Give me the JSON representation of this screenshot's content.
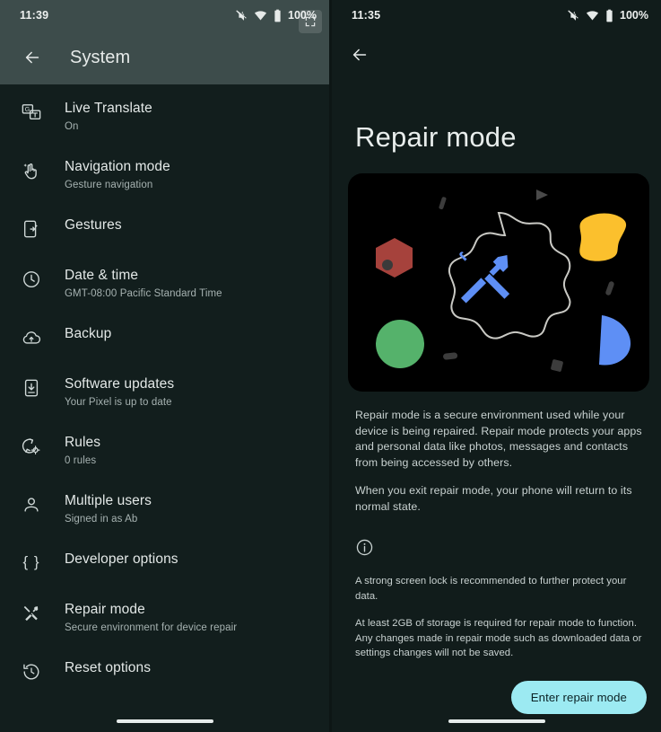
{
  "left": {
    "status": {
      "time": "11:39",
      "battery": "100%",
      "icons": [
        "mute-icon",
        "wifi-icon",
        "battery-icon"
      ],
      "overlay_badge": "fullscreen-icon"
    },
    "toolbar": {
      "title": "System",
      "back": "back-arrow-icon"
    },
    "items": [
      {
        "icon": "live-translate-icon",
        "title": "Live Translate",
        "sub": "On"
      },
      {
        "icon": "gesture-hand-icon",
        "title": "Navigation mode",
        "sub": "Gesture navigation"
      },
      {
        "icon": "gestures-phone-icon",
        "title": "Gestures",
        "sub": ""
      },
      {
        "icon": "clock-icon",
        "title": "Date & time",
        "sub": "GMT-08:00 Pacific Standard Time"
      },
      {
        "icon": "cloud-upload-icon",
        "title": "Backup",
        "sub": ""
      },
      {
        "icon": "software-update-icon",
        "title": "Software updates",
        "sub": "Your Pixel is up to date"
      },
      {
        "icon": "rules-gear-icon",
        "title": "Rules",
        "sub": "0 rules"
      },
      {
        "icon": "person-icon",
        "title": "Multiple users",
        "sub": "Signed in as Ab"
      },
      {
        "icon": "curly-braces-icon",
        "title": "Developer options",
        "sub": ""
      },
      {
        "icon": "repair-tools-icon",
        "title": "Repair mode",
        "sub": "Secure environment for device repair"
      },
      {
        "icon": "history-reset-icon",
        "title": "Reset options",
        "sub": ""
      }
    ]
  },
  "right": {
    "status": {
      "time": "11:35",
      "battery": "100%",
      "icons": [
        "mute-icon",
        "wifi-icon",
        "battery-icon"
      ]
    },
    "back": "back-arrow-icon",
    "title": "Repair mode",
    "hero": {
      "name": "repair-mode-illustration",
      "center_icon": "hammer-screwdriver-icon",
      "colors": {
        "background": "#000000",
        "hexagon_red": "#a6423c",
        "rounded_square_yellow": "#fbc02d",
        "circle_green": "#55b26b",
        "half_moon_blue": "#5e8ff5",
        "tools_blue": "#5e8ff5",
        "outline": "#c9c9c4"
      }
    },
    "paragraphs": [
      "Repair mode is a secure environment used while your device is being repaired. Repair mode protects your apps and personal data like photos, messages and contacts from being accessed by others.",
      "When you exit repair mode, your phone will return to its normal state."
    ],
    "info_icon": "info-circle-icon",
    "notes": [
      "A strong screen lock is recommended to further protect your data.",
      "At least 2GB of storage is required for repair mode to function. Any changes made in repair mode such as downloaded data or settings changes will not be saved."
    ],
    "cta_label": "Enter repair mode",
    "cta_color": "#9ceaf2"
  }
}
